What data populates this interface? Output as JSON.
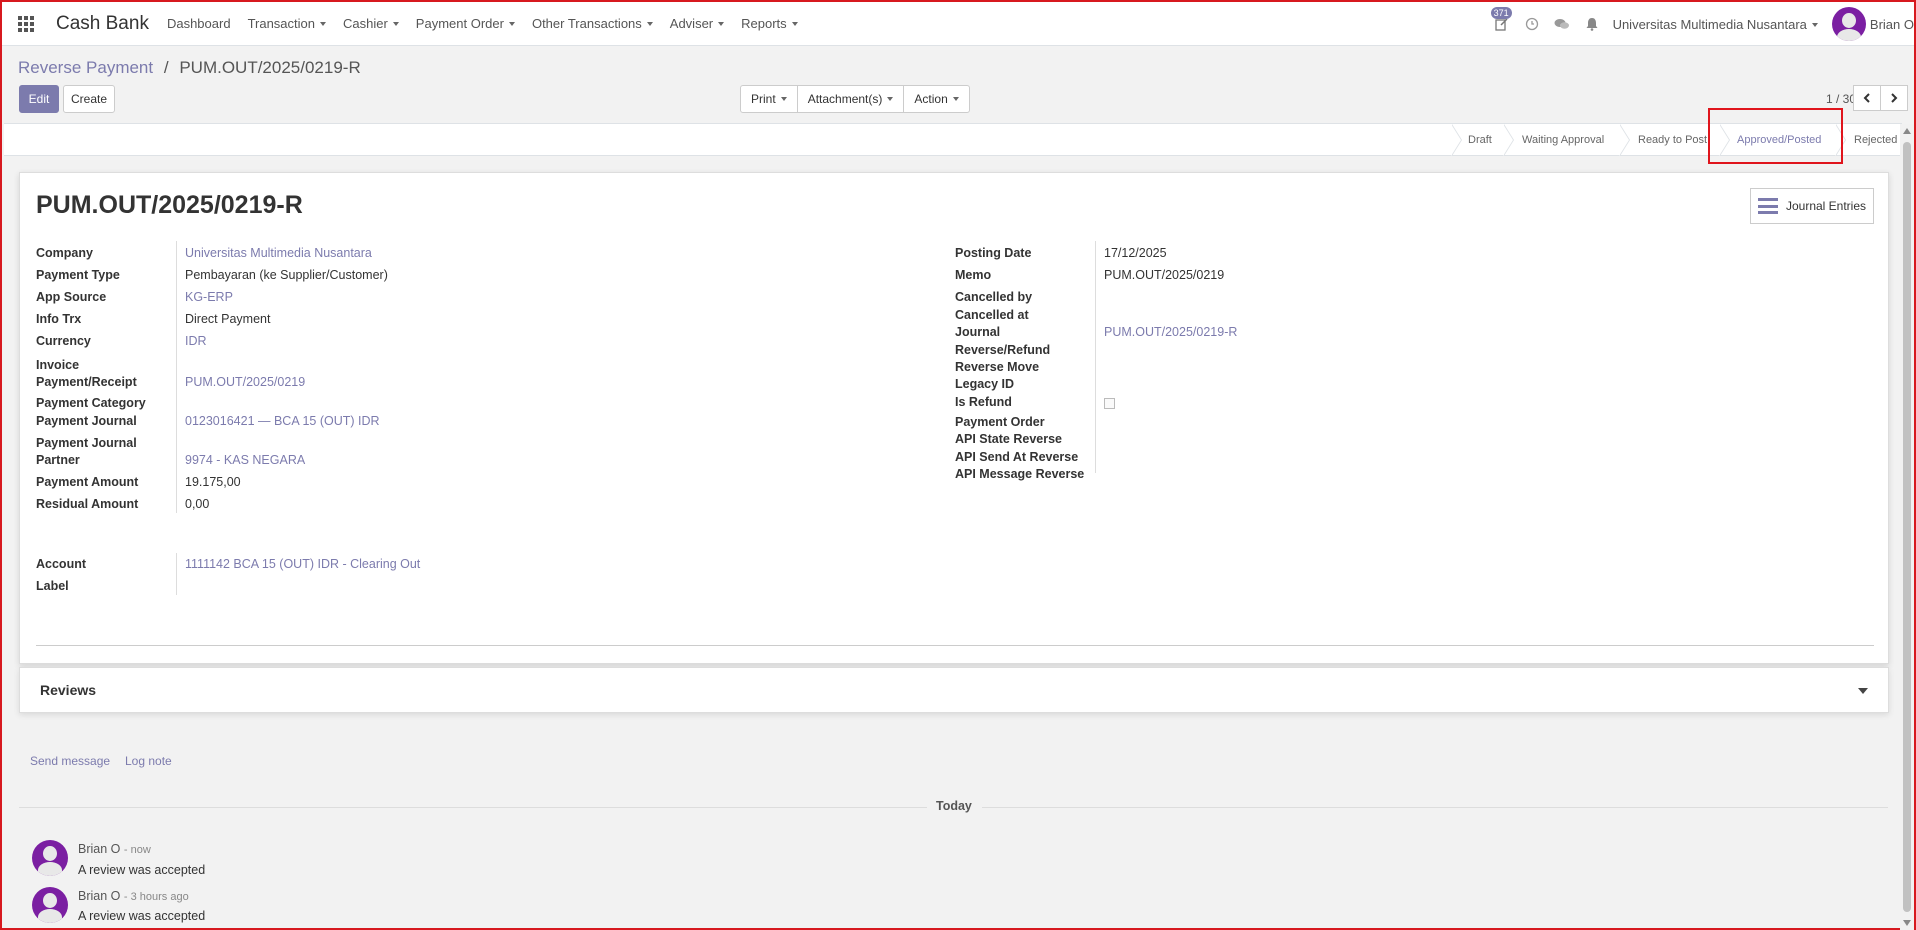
{
  "navbar": {
    "brand": "Cash Bank",
    "menu": [
      "Dashboard",
      "Transaction",
      "Cashier",
      "Payment Order",
      "Other Transactions",
      "Adviser",
      "Reports"
    ],
    "activity_count": "371",
    "company": "Universitas Multimedia Nusantara",
    "user": "Brian O"
  },
  "breadcrumb": {
    "parent": "Reverse Payment",
    "separator": "/",
    "current": "PUM.OUT/2025/0219-R"
  },
  "actions": {
    "edit": "Edit",
    "create": "Create",
    "print": "Print",
    "attachments": "Attachment(s)",
    "action": "Action"
  },
  "pager": {
    "value": "1 / 30"
  },
  "statusbar": {
    "stages": [
      "Draft",
      "Waiting Approval",
      "Ready to Post",
      "Approved/Posted",
      "Rejected"
    ],
    "active": "Approved/Posted"
  },
  "record": {
    "title": "PUM.OUT/2025/0219-R",
    "journal_entries_button": "Journal Entries",
    "left": {
      "company_label": "Company",
      "company": "Universitas Multimedia Nusantara",
      "payment_type_label": "Payment Type",
      "payment_type": "Pembayaran (ke Supplier/Customer)",
      "app_source_label": "App Source",
      "app_source": "KG-ERP",
      "info_trx_label": "Info Trx",
      "info_trx": "Direct Payment",
      "currency_label": "Currency",
      "currency": "IDR",
      "invoice_label_1": "Invoice",
      "invoice_label_2": "Payment/Receipt",
      "invoice": "PUM.OUT/2025/0219",
      "payment_category_label": "Payment Category",
      "payment_journal_label": "Payment Journal",
      "payment_journal": "0123016421 — BCA 15 (OUT) IDR",
      "payment_journal_partner_label_1": "Payment Journal",
      "payment_journal_partner_label_2": "Partner",
      "payment_journal_partner": "9974 - KAS NEGARA",
      "payment_amount_label": "Payment Amount",
      "payment_amount": "19.175,00",
      "residual_amount_label": "Residual Amount",
      "residual_amount": "0,00",
      "account_label": "Account",
      "account": "1111142 BCA 15 (OUT) IDR - Clearing Out",
      "label_label": "Label"
    },
    "right": {
      "posting_date_label": "Posting Date",
      "posting_date": "17/12/2025",
      "memo_label": "Memo",
      "memo": "PUM.OUT/2025/0219",
      "cancelled_by_label": "Cancelled by",
      "cancelled_at_label": "Cancelled at",
      "journal_label": "Journal",
      "journal": "PUM.OUT/2025/0219-R",
      "reverse_refund_label": "Reverse/Refund",
      "reverse_move_label": "Reverse Move",
      "legacy_id_label": "Legacy ID",
      "is_refund_label": "Is Refund",
      "payment_order_label": "Payment Order",
      "api_state_reverse_label": "API State Reverse",
      "api_send_at_reverse_label": "API Send At Reverse",
      "api_message_reverse_label": "API Message Reverse"
    }
  },
  "reviews": {
    "title": "Reviews"
  },
  "chatter": {
    "send_message": "Send message",
    "log_note": "Log note",
    "today": "Today",
    "messages": [
      {
        "author": "Brian O",
        "time": "- now",
        "body": "A review was accepted"
      },
      {
        "author": "Brian O",
        "time": "- 3 hours ago",
        "body": "A review was accepted"
      }
    ]
  },
  "colors": {
    "accent": "#7c7bad",
    "highlight": "#e0151d",
    "avatar": "#7b1fa2"
  }
}
